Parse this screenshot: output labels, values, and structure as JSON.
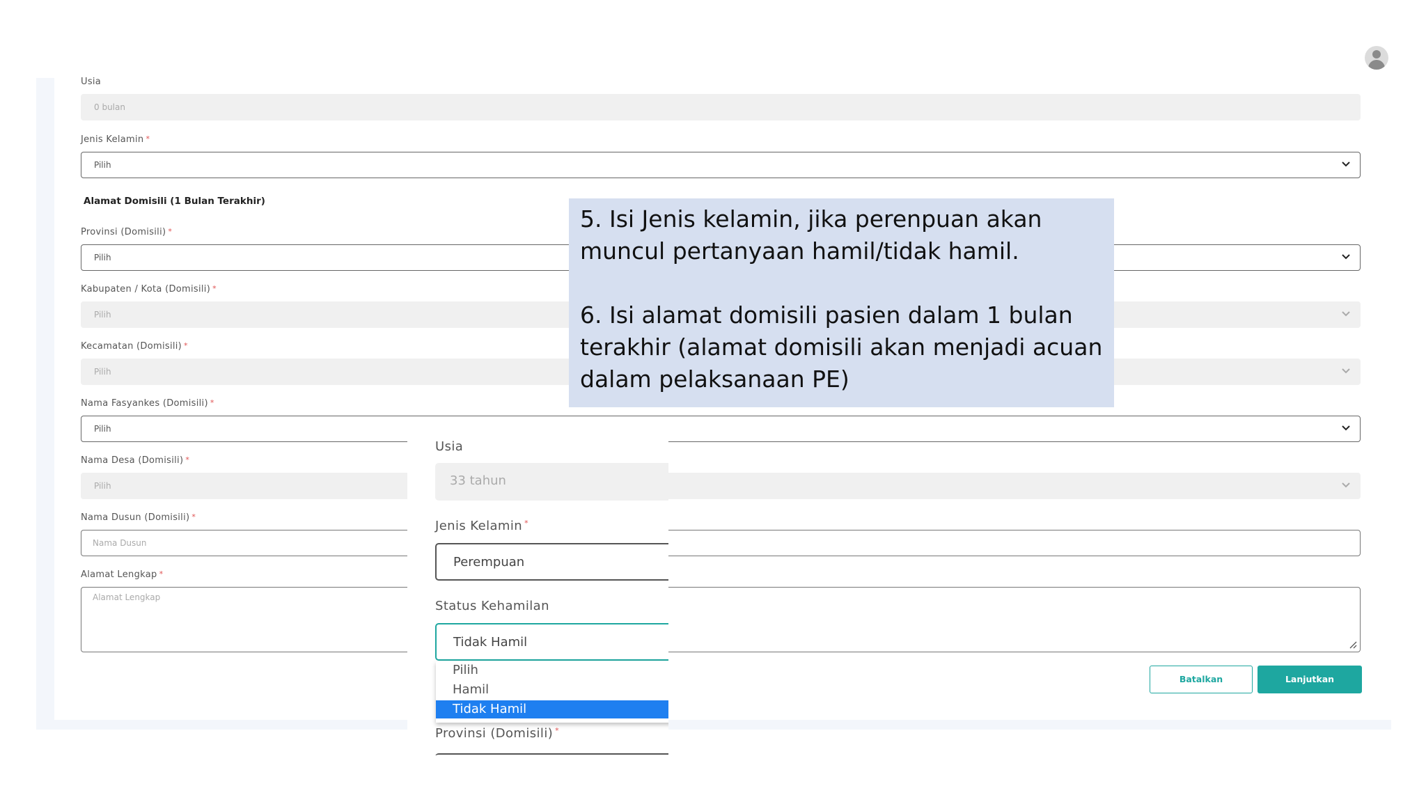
{
  "form": {
    "usia_label": "Usia",
    "usia_value": "0 bulan",
    "jenis_kelamin_label": "Jenis Kelamin",
    "jenis_kelamin_value": "Pilih",
    "section_title": "Alamat Domisili (1 Bulan Terakhir)",
    "provinsi_label": "Provinsi (Domisili)",
    "provinsi_value": "Pilih",
    "kabupaten_label": "Kabupaten / Kota (Domisili)",
    "kabupaten_value": "Pilih",
    "kecamatan_label": "Kecamatan (Domisili)",
    "kecamatan_value": "Pilih",
    "fasyankes_label": "Nama Fasyankes (Domisili)",
    "fasyankes_value": "Pilih",
    "desa_label": "Nama Desa (Domisili)",
    "desa_value": "Pilih",
    "dusun_label": "Nama Dusun (Domisili)",
    "dusun_placeholder": "Nama Dusun",
    "alamat_label": "Alamat Lengkap",
    "alamat_placeholder": "Alamat Lengkap",
    "required_mark": "*"
  },
  "buttons": {
    "cancel": "Batalkan",
    "next": "Lanjutkan"
  },
  "note": {
    "line1": "5. Isi Jenis kelamin, jika perenpuan akan",
    "line2": "muncul pertanyaan hamil/tidak hamil.",
    "line3": "6. Isi alamat domisili pasien dalam 1 bulan",
    "line4": "terakhir (alamat domisili akan menjadi acuan",
    "line5": "dalam pelaksanaan PE)"
  },
  "zoom": {
    "usia_label": "Usia",
    "usia_value": "33 tahun",
    "jenis_kelamin_label": "Jenis Kelamin",
    "jenis_kelamin_value": "Perempuan",
    "status_label": "Status Kehamilan",
    "status_value": "Tidak Hamil",
    "options": [
      "Pilih",
      "Hamil",
      "Tidak Hamil"
    ],
    "provinsi_label": "Provinsi (Domisili)"
  },
  "colors": {
    "accent": "#1ea7a0",
    "note_bg": "#d6dff0",
    "selected_option": "#1e7ff0"
  },
  "icons": {
    "chevron": "chevron-down-icon",
    "avatar": "user-avatar-icon"
  }
}
